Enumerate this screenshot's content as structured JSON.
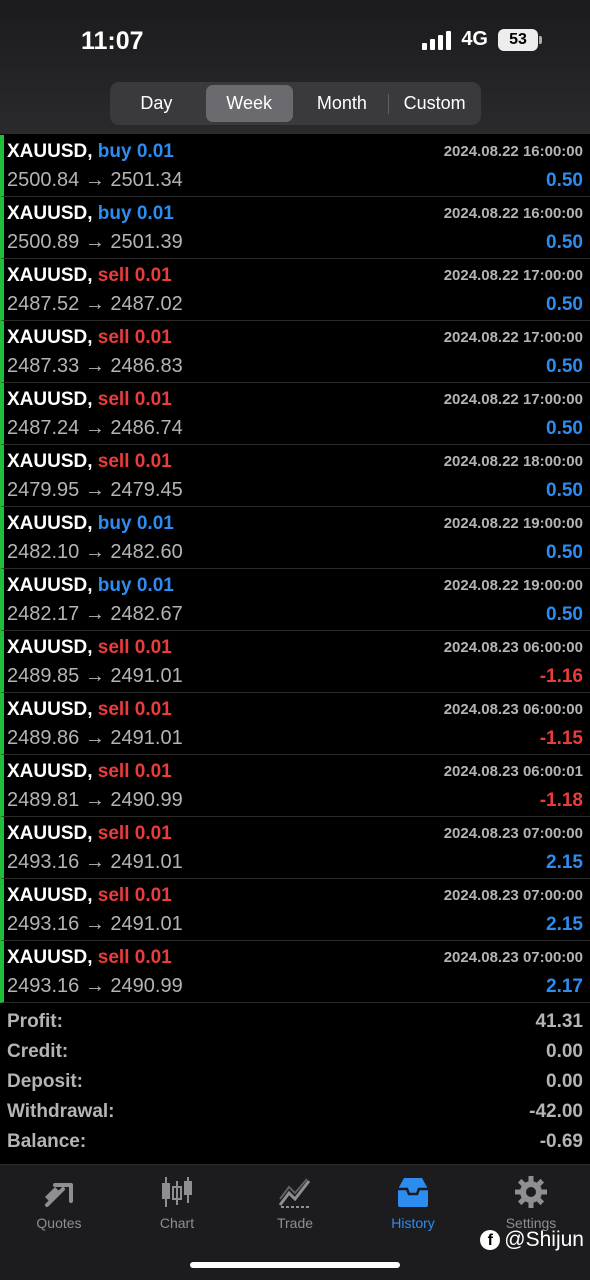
{
  "status_bar": {
    "time": "11:07",
    "network": "4G",
    "battery": "53"
  },
  "period_tabs": [
    {
      "label": "Day"
    },
    {
      "label": "Week"
    },
    {
      "label": "Month"
    },
    {
      "label": "Custom"
    }
  ],
  "active_period": "Week",
  "trades": [
    {
      "symbol": "XAUUSD,",
      "side": "buy 0.01",
      "type": "buy",
      "open": "2500.84",
      "close": "2501.34",
      "time": "2024.08.22 16:00:00",
      "profit": "0.50"
    },
    {
      "symbol": "XAUUSD,",
      "side": "buy 0.01",
      "type": "buy",
      "open": "2500.89",
      "close": "2501.39",
      "time": "2024.08.22 16:00:00",
      "profit": "0.50"
    },
    {
      "symbol": "XAUUSD,",
      "side": "sell 0.01",
      "type": "sell",
      "open": "2487.52",
      "close": "2487.02",
      "time": "2024.08.22 17:00:00",
      "profit": "0.50"
    },
    {
      "symbol": "XAUUSD,",
      "side": "sell 0.01",
      "type": "sell",
      "open": "2487.33",
      "close": "2486.83",
      "time": "2024.08.22 17:00:00",
      "profit": "0.50"
    },
    {
      "symbol": "XAUUSD,",
      "side": "sell 0.01",
      "type": "sell",
      "open": "2487.24",
      "close": "2486.74",
      "time": "2024.08.22 17:00:00",
      "profit": "0.50"
    },
    {
      "symbol": "XAUUSD,",
      "side": "sell 0.01",
      "type": "sell",
      "open": "2479.95",
      "close": "2479.45",
      "time": "2024.08.22 18:00:00",
      "profit": "0.50"
    },
    {
      "symbol": "XAUUSD,",
      "side": "buy 0.01",
      "type": "buy",
      "open": "2482.10",
      "close": "2482.60",
      "time": "2024.08.22 19:00:00",
      "profit": "0.50"
    },
    {
      "symbol": "XAUUSD,",
      "side": "buy 0.01",
      "type": "buy",
      "open": "2482.17",
      "close": "2482.67",
      "time": "2024.08.22 19:00:00",
      "profit": "0.50"
    },
    {
      "symbol": "XAUUSD,",
      "side": "sell 0.01",
      "type": "sell",
      "open": "2489.85",
      "close": "2491.01",
      "time": "2024.08.23 06:00:00",
      "profit": "-1.16"
    },
    {
      "symbol": "XAUUSD,",
      "side": "sell 0.01",
      "type": "sell",
      "open": "2489.86",
      "close": "2491.01",
      "time": "2024.08.23 06:00:00",
      "profit": "-1.15"
    },
    {
      "symbol": "XAUUSD,",
      "side": "sell 0.01",
      "type": "sell",
      "open": "2489.81",
      "close": "2490.99",
      "time": "2024.08.23 06:00:01",
      "profit": "-1.18"
    },
    {
      "symbol": "XAUUSD,",
      "side": "sell 0.01",
      "type": "sell",
      "open": "2493.16",
      "close": "2491.01",
      "time": "2024.08.23 07:00:00",
      "profit": "2.15"
    },
    {
      "symbol": "XAUUSD,",
      "side": "sell 0.01",
      "type": "sell",
      "open": "2493.16",
      "close": "2491.01",
      "time": "2024.08.23 07:00:00",
      "profit": "2.15"
    },
    {
      "symbol": "XAUUSD,",
      "side": "sell 0.01",
      "type": "sell",
      "open": "2493.16",
      "close": "2490.99",
      "time": "2024.08.23 07:00:00",
      "profit": "2.17"
    }
  ],
  "arrow": "→",
  "summary": [
    {
      "label": "Profit:",
      "value": "41.31"
    },
    {
      "label": "Credit:",
      "value": "0.00"
    },
    {
      "label": "Deposit:",
      "value": "0.00"
    },
    {
      "label": "Withdrawal:",
      "value": "-42.00"
    },
    {
      "label": "Balance:",
      "value": "-0.69"
    }
  ],
  "tabbar": [
    {
      "label": "Quotes",
      "icon": "quotes-icon"
    },
    {
      "label": "Chart",
      "icon": "chart-icon"
    },
    {
      "label": "Trade",
      "icon": "trade-icon"
    },
    {
      "label": "History",
      "icon": "history-icon"
    },
    {
      "label": "Settings",
      "icon": "gear-icon"
    }
  ],
  "active_tab": "History",
  "watermark": "@Shijun",
  "colors": {
    "buy": "#2d8cf0",
    "sell": "#ec3b3b",
    "accent": "#2d8cf0",
    "row_marker": "#1fbf3a"
  }
}
